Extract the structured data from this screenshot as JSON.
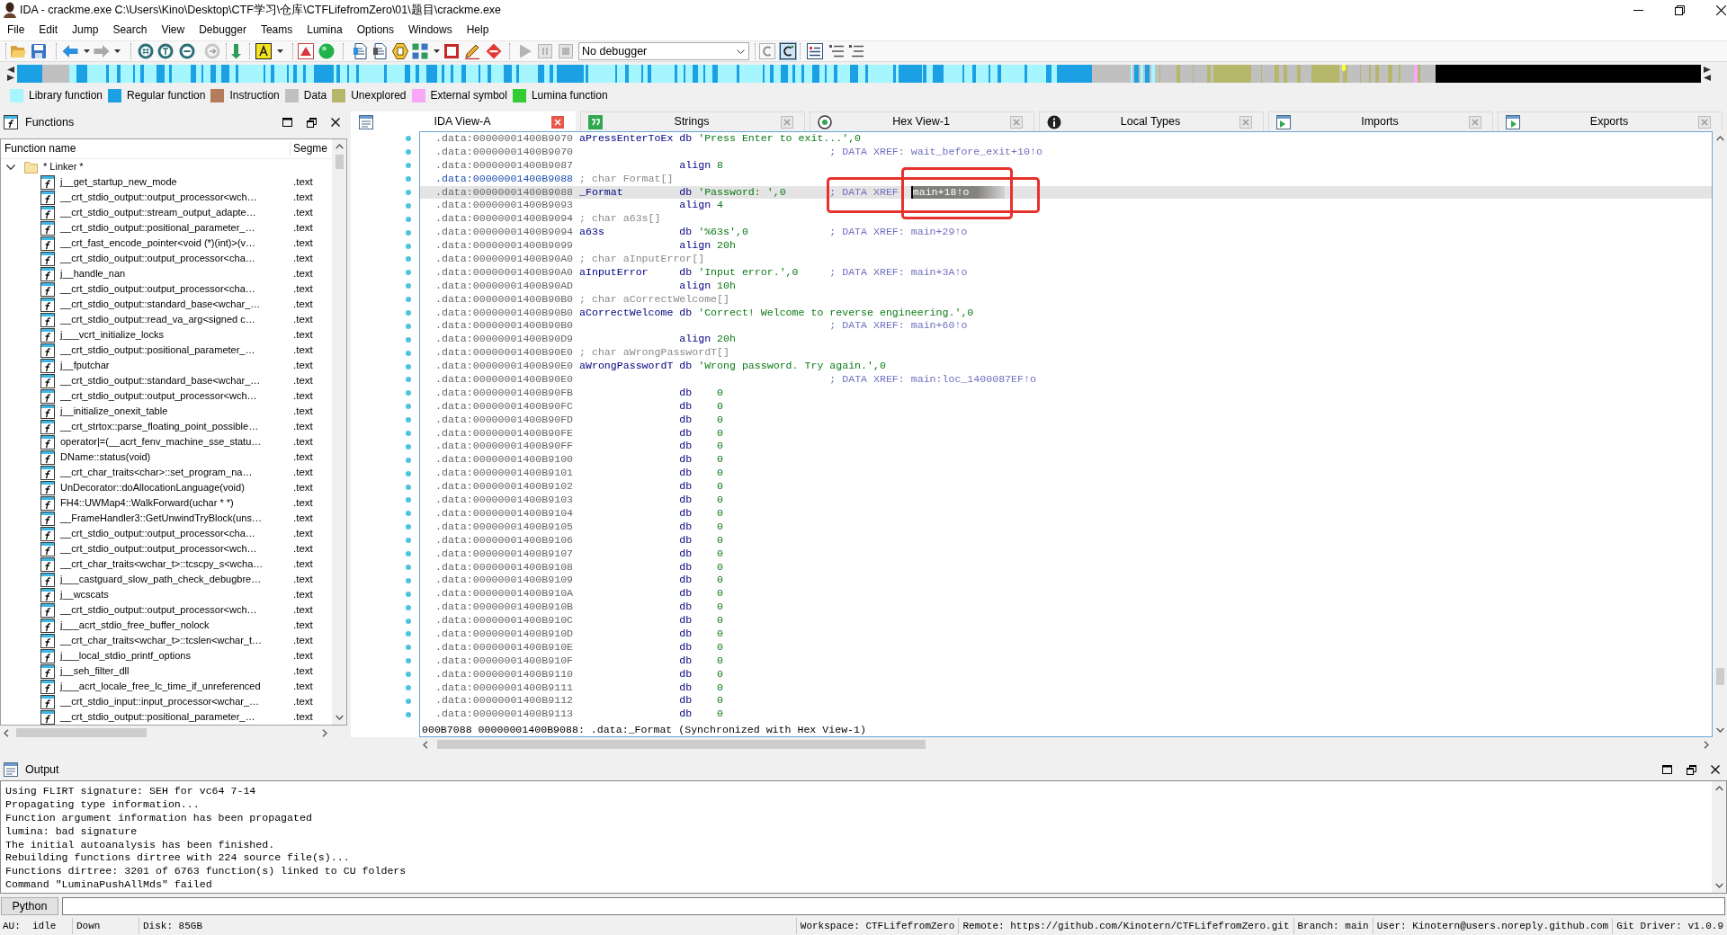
{
  "window": {
    "title": "IDA - crackme.exe C:\\Users\\Kino\\Desktop\\CTF学习\\仓库\\CTFLifefromZero\\01\\题目\\crackme.exe"
  },
  "menu": [
    "File",
    "Edit",
    "Jump",
    "Search",
    "View",
    "Debugger",
    "Teams",
    "Lumina",
    "Options",
    "Windows",
    "Help"
  ],
  "toolbar": {
    "debugger": "No debugger",
    "toggles": [
      {
        "on": false
      },
      {
        "on": true
      }
    ]
  },
  "legend": [
    {
      "label": "Library function",
      "color": "#a6f6ff"
    },
    {
      "label": "Regular function",
      "color": "#1ca0e4"
    },
    {
      "label": "Instruction",
      "color": "#b47c5c"
    },
    {
      "label": "Data",
      "color": "#c0c0c0"
    },
    {
      "label": "Unexplored",
      "color": "#b7b76b"
    },
    {
      "label": "External symbol",
      "color": "#f7a8f7"
    },
    {
      "label": "Lumina function",
      "color": "#33cc33"
    }
  ],
  "functions": {
    "title": "Functions",
    "columns": [
      "Function name",
      "Segme"
    ],
    "tree": [
      {
        "name": "* Linker *",
        "expanded": true,
        "children": [
          {
            "name": "j__get_startup_new_mode",
            "segment": ".text"
          },
          {
            "name": "__crt_stdio_output::output_processor<wch…",
            "segment": ".text"
          },
          {
            "name": "__crt_stdio_output::stream_output_adapte…",
            "segment": ".text"
          },
          {
            "name": "__crt_stdio_output::positional_parameter_…",
            "segment": ".text"
          },
          {
            "name": "__crt_fast_encode_pointer<void (*)(int)>(v…",
            "segment": ".text"
          },
          {
            "name": "__crt_stdio_output::output_processor<cha…",
            "segment": ".text"
          },
          {
            "name": "j__handle_nan",
            "segment": ".text"
          },
          {
            "name": "__crt_stdio_output::output_processor<cha…",
            "segment": ".text"
          },
          {
            "name": "__crt_stdio_output::standard_base<wchar_…",
            "segment": ".text"
          },
          {
            "name": "__crt_stdio_output::read_va_arg<signed c…",
            "segment": ".text"
          },
          {
            "name": "j___vcrt_initialize_locks",
            "segment": ".text"
          },
          {
            "name": "__crt_stdio_output::positional_parameter_…",
            "segment": ".text"
          },
          {
            "name": "j__fputchar",
            "segment": ".text"
          },
          {
            "name": "__crt_stdio_output::standard_base<wchar_…",
            "segment": ".text"
          },
          {
            "name": "__crt_stdio_output::output_processor<wch…",
            "segment": ".text"
          },
          {
            "name": "j__initialize_onexit_table",
            "segment": ".text"
          },
          {
            "name": "__crt_strtox::parse_floating_point_possible…",
            "segment": ".text"
          },
          {
            "name": "operator|=(__acrt_fenv_machine_sse_statu…",
            "segment": ".text"
          },
          {
            "name": "DName::status(void)",
            "segment": ".text"
          },
          {
            "name": "__crt_char_traits<char>::set_program_na…",
            "segment": ".text"
          },
          {
            "name": "UnDecorator::doAllocationLanguage(void)",
            "segment": ".text"
          },
          {
            "name": "FH4::UWMap4::WalkForward(uchar * *)",
            "segment": ".text"
          },
          {
            "name": "__FrameHandler3::GetUnwindTryBlock(uns…",
            "segment": ".text"
          },
          {
            "name": "__crt_stdio_output::output_processor<cha…",
            "segment": ".text"
          },
          {
            "name": "__crt_stdio_output::output_processor<wch…",
            "segment": ".text"
          },
          {
            "name": "__crt_char_traits<wchar_t>::tcscpy_s<wcha…",
            "segment": ".text"
          },
          {
            "name": "j___castguard_slow_path_check_debugbre…",
            "segment": ".text"
          },
          {
            "name": "j__wcscats",
            "segment": ".text"
          },
          {
            "name": "__crt_stdio_output::output_processor<wch…",
            "segment": ".text"
          },
          {
            "name": "j___acrt_stdio_free_buffer_nolock",
            "segment": ".text"
          },
          {
            "name": "__crt_char_traits<wchar_t>::tcslen<wchar_t…",
            "segment": ".text"
          },
          {
            "name": "j___local_stdio_printf_options",
            "segment": ".text"
          },
          {
            "name": "j__seh_filter_dll",
            "segment": ".text"
          },
          {
            "name": "j___acrt_locale_free_lc_time_if_unreferenced",
            "segment": ".text"
          },
          {
            "name": "__crt_stdio_input::input_processor<wchar_…",
            "segment": ".text"
          },
          {
            "name": "__crt_stdio_output::positional_parameter_…",
            "segment": ".text"
          }
        ]
      }
    ]
  },
  "tabs": [
    {
      "label": "IDA View-A",
      "kind": "disassembly",
      "selected": true
    },
    {
      "label": "Strings",
      "kind": "strings",
      "selected": false
    },
    {
      "label": "Hex View-1",
      "kind": "hex",
      "selected": false
    },
    {
      "label": "Local Types",
      "kind": "types",
      "selected": false
    },
    {
      "label": "Imports",
      "kind": "imports",
      "selected": false
    },
    {
      "label": "Exports",
      "kind": "exports",
      "selected": false
    }
  ],
  "disassembly": {
    "lines": [
      {
        "kind": "def",
        "address": ".data:00000001400B9070",
        "label": "aPressEnterToEx",
        "mnemonic": "db",
        "operand": "'Press Enter to exit...',0",
        "selected": false,
        "highlighted": false,
        "boxed": false
      },
      {
        "kind": "xref",
        "address": ".data:00000001400B9070",
        "comment": "; DATA XREF: wait_before_exit+10↑o",
        "selected": false,
        "highlighted": false,
        "boxed": false
      },
      {
        "kind": "align",
        "address": ".data:00000001400B9087",
        "mnemonic": "align",
        "operand": "8",
        "selected": false,
        "highlighted": false,
        "boxed": false
      },
      {
        "kind": "decl",
        "address": ".data:00000001400B9088",
        "comment": "; char Format[]",
        "selected": false,
        "highlighted": true,
        "boxed": false
      },
      {
        "kind": "def",
        "address": ".data:00000001400B9088",
        "label": "_Format",
        "mnemonic": "db",
        "operand": "'Password: ',0",
        "comment": "; DATA XREF",
        "selection": "main+18↑o",
        "selected": true,
        "highlighted": false,
        "boxed": true
      },
      {
        "kind": "align",
        "address": ".data:00000001400B9093",
        "mnemonic": "align",
        "operand": "4",
        "selected": false,
        "highlighted": false,
        "boxed": false
      },
      {
        "kind": "decl",
        "address": ".data:00000001400B9094",
        "comment": "; char a63s[]",
        "selected": false,
        "highlighted": false,
        "boxed": false
      },
      {
        "kind": "def",
        "address": ".data:00000001400B9094",
        "label": "a63s",
        "mnemonic": "db",
        "operand": "'%63s',0",
        "comment": "; DATA XREF: main+29↑o",
        "selected": false,
        "highlighted": false,
        "boxed": false
      },
      {
        "kind": "align",
        "address": ".data:00000001400B9099",
        "mnemonic": "align",
        "operand": "20h",
        "selected": false,
        "highlighted": false,
        "boxed": false
      },
      {
        "kind": "decl",
        "address": ".data:00000001400B90A0",
        "comment": "; char aInputError[]",
        "selected": false,
        "highlighted": false,
        "boxed": false
      },
      {
        "kind": "def",
        "address": ".data:00000001400B90A0",
        "label": "aInputError",
        "mnemonic": "db",
        "operand": "'Input error.',0",
        "comment": "; DATA XREF: main+3A↑o",
        "selected": false,
        "highlighted": false,
        "boxed": false
      },
      {
        "kind": "align",
        "address": ".data:00000001400B90AD",
        "mnemonic": "align",
        "operand": "10h",
        "selected": false,
        "highlighted": false,
        "boxed": false
      },
      {
        "kind": "decl",
        "address": ".data:00000001400B90B0",
        "comment": "; char aCorrectWelcome[]",
        "selected": false,
        "highlighted": false,
        "boxed": false
      },
      {
        "kind": "def",
        "address": ".data:00000001400B90B0",
        "label": "aCorrectWelcome",
        "mnemonic": "db",
        "operand": "'Correct! Welcome to reverse engineering.',0",
        "selected": false,
        "highlighted": false,
        "boxed": false
      },
      {
        "kind": "xref",
        "address": ".data:00000001400B90B0",
        "comment": "; DATA XREF: main+60↑o",
        "selected": false,
        "highlighted": false,
        "boxed": false
      },
      {
        "kind": "align",
        "address": ".data:00000001400B90D9",
        "mnemonic": "align",
        "operand": "20h",
        "selected": false,
        "highlighted": false,
        "boxed": false
      },
      {
        "kind": "decl",
        "address": ".data:00000001400B90E0",
        "comment": "; char aWrongPasswordT[]",
        "selected": false,
        "highlighted": false,
        "boxed": false
      },
      {
        "kind": "def",
        "address": ".data:00000001400B90E0",
        "label": "aWrongPasswordT",
        "mnemonic": "db",
        "operand": "'Wrong password. Try again.',0",
        "selected": false,
        "highlighted": false,
        "boxed": false
      },
      {
        "kind": "xref",
        "address": ".data:00000001400B90E0",
        "comment": "; DATA XREF: main:loc_1400087EF↑o",
        "selected": false,
        "highlighted": false,
        "boxed": false
      },
      {
        "kind": "byte",
        "address": ".data:00000001400B90FB",
        "mnemonic": "db",
        "operand": "0",
        "selected": false,
        "highlighted": false,
        "boxed": false
      },
      {
        "kind": "byte",
        "address": ".data:00000001400B90FC",
        "mnemonic": "db",
        "operand": "0",
        "selected": false,
        "highlighted": false,
        "boxed": false
      },
      {
        "kind": "byte",
        "address": ".data:00000001400B90FD",
        "mnemonic": "db",
        "operand": "0",
        "selected": false,
        "highlighted": false,
        "boxed": false
      },
      {
        "kind": "byte",
        "address": ".data:00000001400B90FE",
        "mnemonic": "db",
        "operand": "0",
        "selected": false,
        "highlighted": false,
        "boxed": false
      },
      {
        "kind": "byte",
        "address": ".data:00000001400B90FF",
        "mnemonic": "db",
        "operand": "0",
        "selected": false,
        "highlighted": false,
        "boxed": false
      },
      {
        "kind": "byte",
        "address": ".data:00000001400B9100",
        "mnemonic": "db",
        "operand": "0",
        "selected": false,
        "highlighted": false,
        "boxed": false
      },
      {
        "kind": "byte",
        "address": ".data:00000001400B9101",
        "mnemonic": "db",
        "operand": "0",
        "selected": false,
        "highlighted": false,
        "boxed": false
      },
      {
        "kind": "byte",
        "address": ".data:00000001400B9102",
        "mnemonic": "db",
        "operand": "0",
        "selected": false,
        "highlighted": false,
        "boxed": false
      },
      {
        "kind": "byte",
        "address": ".data:00000001400B9103",
        "mnemonic": "db",
        "operand": "0",
        "selected": false,
        "highlighted": false,
        "boxed": false
      },
      {
        "kind": "byte",
        "address": ".data:00000001400B9104",
        "mnemonic": "db",
        "operand": "0",
        "selected": false,
        "highlighted": false,
        "boxed": false
      },
      {
        "kind": "byte",
        "address": ".data:00000001400B9105",
        "mnemonic": "db",
        "operand": "0",
        "selected": false,
        "highlighted": false,
        "boxed": false
      },
      {
        "kind": "byte",
        "address": ".data:00000001400B9106",
        "mnemonic": "db",
        "operand": "0",
        "selected": false,
        "highlighted": false,
        "boxed": false
      },
      {
        "kind": "byte",
        "address": ".data:00000001400B9107",
        "mnemonic": "db",
        "operand": "0",
        "selected": false,
        "highlighted": false,
        "boxed": false
      },
      {
        "kind": "byte",
        "address": ".data:00000001400B9108",
        "mnemonic": "db",
        "operand": "0",
        "selected": false,
        "highlighted": false,
        "boxed": false
      },
      {
        "kind": "byte",
        "address": ".data:00000001400B9109",
        "mnemonic": "db",
        "operand": "0",
        "selected": false,
        "highlighted": false,
        "boxed": false
      },
      {
        "kind": "byte",
        "address": ".data:00000001400B910A",
        "mnemonic": "db",
        "operand": "0",
        "selected": false,
        "highlighted": false,
        "boxed": false
      },
      {
        "kind": "byte",
        "address": ".data:00000001400B910B",
        "mnemonic": "db",
        "operand": "0",
        "selected": false,
        "highlighted": false,
        "boxed": false
      },
      {
        "kind": "byte",
        "address": ".data:00000001400B910C",
        "mnemonic": "db",
        "operand": "0",
        "selected": false,
        "highlighted": false,
        "boxed": false
      },
      {
        "kind": "byte",
        "address": ".data:00000001400B910D",
        "mnemonic": "db",
        "operand": "0",
        "selected": false,
        "highlighted": false,
        "boxed": false
      },
      {
        "kind": "byte",
        "address": ".data:00000001400B910E",
        "mnemonic": "db",
        "operand": "0",
        "selected": false,
        "highlighted": false,
        "boxed": false
      },
      {
        "kind": "byte",
        "address": ".data:00000001400B910F",
        "mnemonic": "db",
        "operand": "0",
        "selected": false,
        "highlighted": false,
        "boxed": false
      },
      {
        "kind": "byte",
        "address": ".data:00000001400B9110",
        "mnemonic": "db",
        "operand": "0",
        "selected": false,
        "highlighted": false,
        "boxed": false
      },
      {
        "kind": "byte",
        "address": ".data:00000001400B9111",
        "mnemonic": "db",
        "operand": "0",
        "selected": false,
        "highlighted": false,
        "boxed": false
      },
      {
        "kind": "byte",
        "address": ".data:00000001400B9112",
        "mnemonic": "db",
        "operand": "0",
        "selected": false,
        "highlighted": false,
        "boxed": false
      },
      {
        "kind": "byte",
        "address": ".data:00000001400B9113",
        "mnemonic": "db",
        "operand": "0",
        "selected": false,
        "highlighted": false,
        "boxed": false
      }
    ],
    "status": "000B7088 00000001400B9088: .data:_Format (Synchronized with Hex View-1)"
  },
  "output": {
    "title": "Output",
    "lines": [
      "Using FLIRT signature: SEH for vc64 7-14",
      "Propagating type information...",
      "Function argument information has been propagated",
      "lumina: bad signature",
      "The initial autoanalysis has been finished.",
      "Rebuilding functions dirtree with 224 source file(s)...",
      "Functions dirtree: 3201 of 6763 function(s) linked to CU folders",
      "Command \"LuminaPushAllMds\" failed"
    ],
    "interpreter": "Python"
  },
  "status_bar": {
    "left": [
      "AU:  idle",
      "Down",
      "Disk: 85GB"
    ],
    "right": [
      "Workspace: CTFLifefromZero",
      "Remote: https://github.com/Kinotern/CTFLifefromZero.git",
      "Branch: main",
      "User: Kinotern@users.noreply.github.com",
      "Git Driver: v1.0.9"
    ]
  }
}
